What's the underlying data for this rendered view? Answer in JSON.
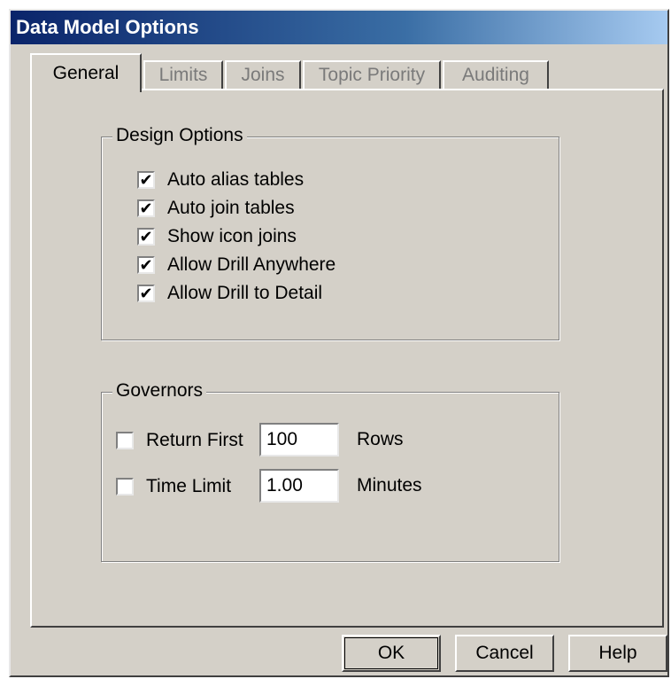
{
  "window": {
    "title": "Data Model Options"
  },
  "tabs": [
    {
      "label": "General",
      "active": true
    },
    {
      "label": "Limits",
      "active": false
    },
    {
      "label": "Joins",
      "active": false
    },
    {
      "label": "Topic Priority",
      "active": false
    },
    {
      "label": "Auditing",
      "active": false
    }
  ],
  "design_options": {
    "title": "Design Options",
    "items": [
      {
        "label": "Auto alias tables",
        "checked": true
      },
      {
        "label": "Auto join tables",
        "checked": true
      },
      {
        "label": "Show icon joins",
        "checked": true
      },
      {
        "label": "Allow Drill Anywhere",
        "checked": true
      },
      {
        "label": "Allow Drill to Detail",
        "checked": true
      }
    ]
  },
  "governors": {
    "title": "Governors",
    "return_first": {
      "label": "Return First",
      "checked": false,
      "value": "100",
      "unit": "Rows"
    },
    "time_limit": {
      "label": "Time Limit",
      "checked": false,
      "value": "1.00",
      "unit": "Minutes"
    }
  },
  "buttons": {
    "ok": "OK",
    "cancel": "Cancel",
    "help": "Help"
  }
}
